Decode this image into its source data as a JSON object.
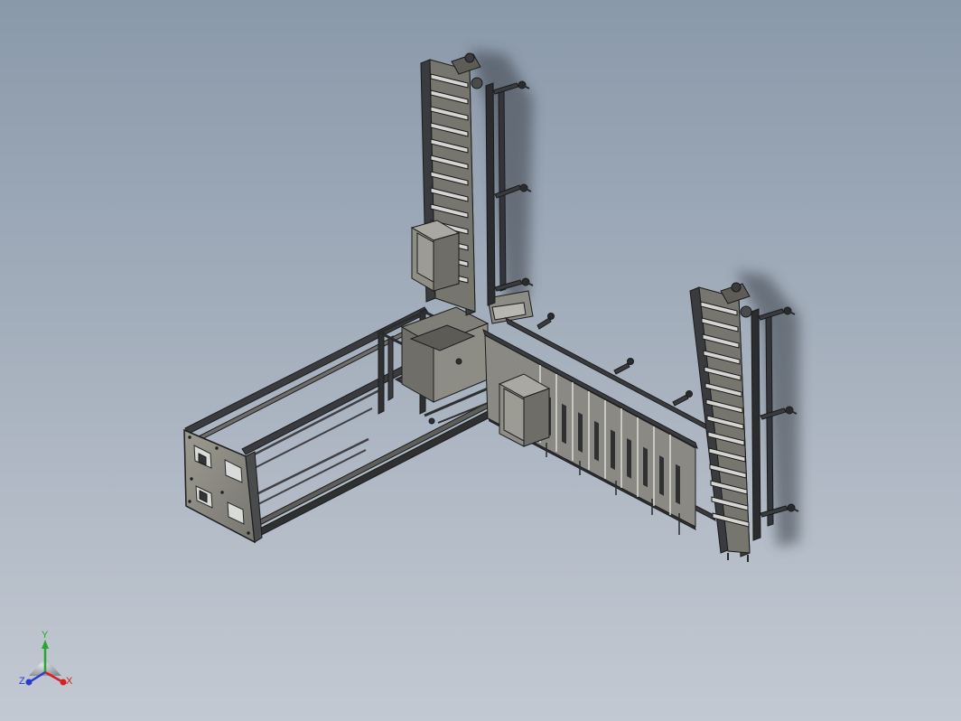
{
  "viewport": {
    "background_top": "#8a99aa",
    "background_bottom": "#c3c9d2"
  },
  "model": {
    "description_icon": "cad-assembly-model",
    "metal_color": "#8e8e86",
    "dark_color": "#2e2f31",
    "edge_color": "#1e1f21"
  },
  "triad": {
    "x_label": "X",
    "y_label": "Y",
    "z_label": "Z",
    "x_color": "#d42020",
    "y_color": "#25a830",
    "z_color": "#2a3bd0"
  }
}
